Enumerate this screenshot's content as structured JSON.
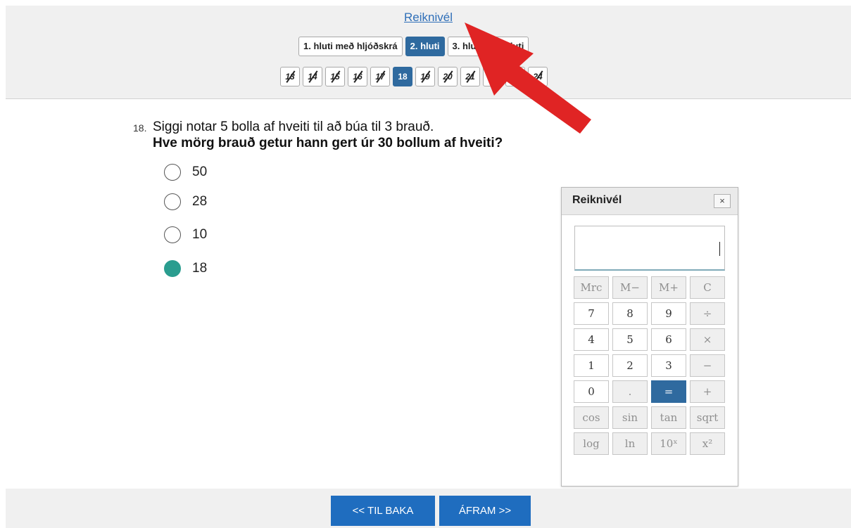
{
  "header": {
    "calculator_link": "Reiknivél",
    "parts": [
      {
        "label": "1. hluti með hljóðskrá",
        "active": false
      },
      {
        "label": "2. hluti",
        "active": true
      },
      {
        "label": "3. hluti",
        "active": false
      },
      {
        "label": "4. hluti",
        "active": false
      }
    ],
    "questions": [
      "13",
      "14",
      "15",
      "16",
      "17",
      "18",
      "19",
      "20",
      "21",
      "22",
      "23",
      "24"
    ],
    "current_question": "18"
  },
  "question": {
    "number": "18.",
    "text": "Siggi notar 5 bolla af hveiti til að búa til 3 brauð.",
    "prompt": "Hve mörg brauð getur hann gert úr 30 bollum af hveiti?",
    "options": [
      {
        "label": "50",
        "selected": false
      },
      {
        "label": "28",
        "selected": false
      },
      {
        "label": "10",
        "selected": false
      },
      {
        "label": "18",
        "selected": true
      }
    ]
  },
  "calculator": {
    "title": "Reiknivél",
    "close": "×",
    "display_value": "",
    "keys": [
      {
        "label": "Mrc",
        "style": "grey"
      },
      {
        "label": "M−",
        "style": "grey"
      },
      {
        "label": "M+",
        "style": "grey"
      },
      {
        "label": "C",
        "style": "grey"
      },
      {
        "label": "7",
        "style": "white"
      },
      {
        "label": "8",
        "style": "white"
      },
      {
        "label": "9",
        "style": "white"
      },
      {
        "label": "÷",
        "style": "grey"
      },
      {
        "label": "4",
        "style": "white"
      },
      {
        "label": "5",
        "style": "white"
      },
      {
        "label": "6",
        "style": "white"
      },
      {
        "label": "×",
        "style": "grey"
      },
      {
        "label": "1",
        "style": "white"
      },
      {
        "label": "2",
        "style": "white"
      },
      {
        "label": "3",
        "style": "white"
      },
      {
        "label": "−",
        "style": "grey"
      },
      {
        "label": "0",
        "style": "white"
      },
      {
        "label": ".",
        "style": "grey"
      },
      {
        "label": "=",
        "style": "eq"
      },
      {
        "label": "+",
        "style": "grey"
      },
      {
        "label": "cos",
        "style": "grey"
      },
      {
        "label": "sin",
        "style": "grey"
      },
      {
        "label": "tan",
        "style": "grey"
      },
      {
        "label": "sqrt",
        "style": "grey"
      },
      {
        "label": "log",
        "style": "grey"
      },
      {
        "label": "ln",
        "style": "grey"
      },
      {
        "label": "10ˣ",
        "style": "grey"
      },
      {
        "label": "x²",
        "style": "grey"
      }
    ]
  },
  "footer": {
    "back_label": "<< TIL BAKA",
    "forward_label": "ÁFRAM >>"
  },
  "colors": {
    "accent": "#2f6a9f",
    "nav_button": "#1f6dbf",
    "selected_radio": "#2a9d8f",
    "annotation_arrow": "#e02424"
  }
}
